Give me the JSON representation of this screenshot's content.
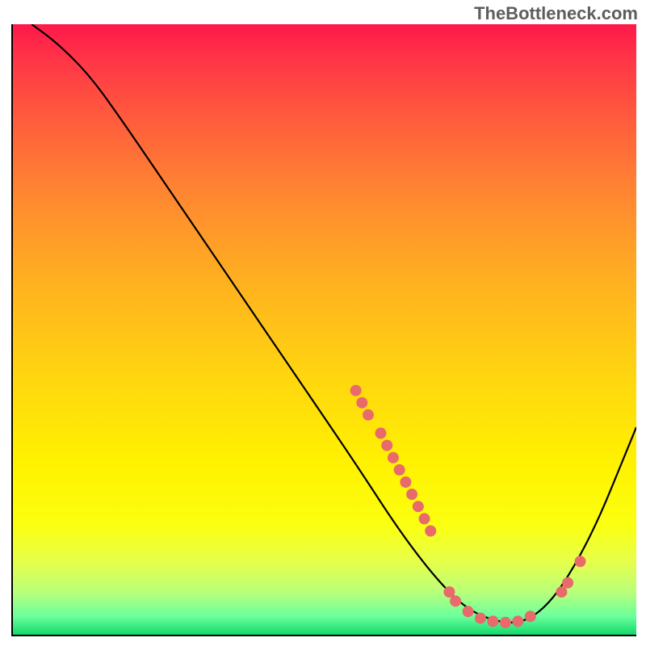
{
  "watermark": "TheBottleneck.com",
  "chart_data": {
    "type": "line",
    "title": "",
    "xlabel": "",
    "ylabel": "",
    "xlim": [
      0,
      100
    ],
    "ylim": [
      0,
      100
    ],
    "curve": [
      {
        "x": 3,
        "y": 100
      },
      {
        "x": 7,
        "y": 97
      },
      {
        "x": 12,
        "y": 92
      },
      {
        "x": 17,
        "y": 85
      },
      {
        "x": 25,
        "y": 73
      },
      {
        "x": 35,
        "y": 58
      },
      {
        "x": 45,
        "y": 43
      },
      {
        "x": 55,
        "y": 28
      },
      {
        "x": 62,
        "y": 17
      },
      {
        "x": 68,
        "y": 9
      },
      {
        "x": 73,
        "y": 4
      },
      {
        "x": 78,
        "y": 2
      },
      {
        "x": 82,
        "y": 2
      },
      {
        "x": 86,
        "y": 5
      },
      {
        "x": 90,
        "y": 11
      },
      {
        "x": 94,
        "y": 19
      },
      {
        "x": 98,
        "y": 29
      },
      {
        "x": 100,
        "y": 34
      }
    ],
    "markers": [
      {
        "x": 55,
        "y": 40
      },
      {
        "x": 56,
        "y": 38
      },
      {
        "x": 57,
        "y": 36
      },
      {
        "x": 59,
        "y": 33
      },
      {
        "x": 60,
        "y": 31
      },
      {
        "x": 61,
        "y": 29
      },
      {
        "x": 62,
        "y": 27
      },
      {
        "x": 63,
        "y": 25
      },
      {
        "x": 64,
        "y": 23
      },
      {
        "x": 65,
        "y": 21
      },
      {
        "x": 66,
        "y": 19
      },
      {
        "x": 67,
        "y": 17
      },
      {
        "x": 70,
        "y": 7
      },
      {
        "x": 71,
        "y": 5.5
      },
      {
        "x": 73,
        "y": 3.8
      },
      {
        "x": 75,
        "y": 2.7
      },
      {
        "x": 77,
        "y": 2.2
      },
      {
        "x": 79,
        "y": 2
      },
      {
        "x": 81,
        "y": 2.2
      },
      {
        "x": 83,
        "y": 3
      },
      {
        "x": 88,
        "y": 7
      },
      {
        "x": 89,
        "y": 8.5
      },
      {
        "x": 91,
        "y": 12
      }
    ],
    "colors": {
      "curve": "#000000",
      "marker": "#e86a6a",
      "gradient_top": "#ff184a",
      "gradient_bottom": "#12d96c"
    }
  }
}
